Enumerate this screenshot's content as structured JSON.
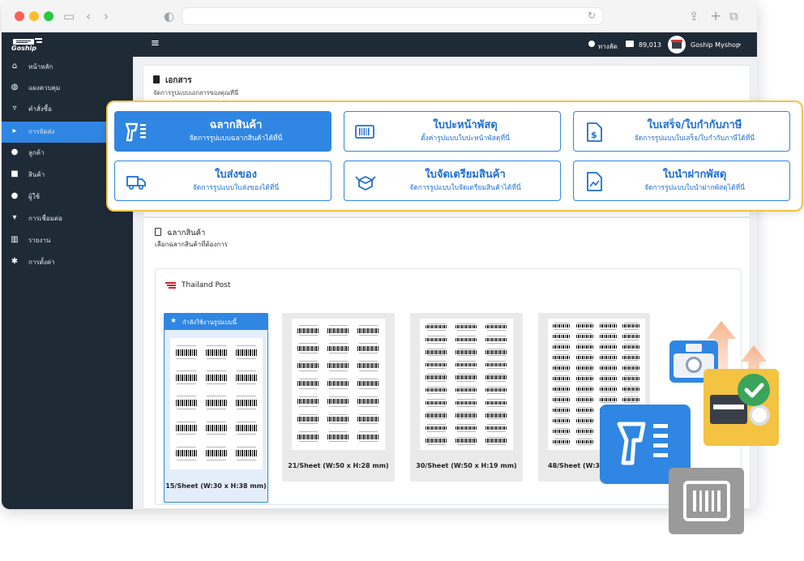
{
  "app": {
    "brand": "Goship",
    "shortcut_label": "ทางลัด",
    "balance": "89,013",
    "shop_name": "Goship Myshop"
  },
  "sidebar": {
    "items": [
      {
        "label": "หน้าหลัก",
        "icon": "home-icon",
        "glyph": "⌂"
      },
      {
        "label": "แผงควบคุม",
        "icon": "dashboard-icon",
        "glyph": "◍"
      },
      {
        "label": "คำสั่งซื้อ",
        "icon": "cart-icon",
        "glyph": "▿"
      },
      {
        "label": "การจัดส่ง",
        "icon": "truck-icon",
        "glyph": "▸",
        "active": true
      },
      {
        "label": "ลูกค้า",
        "icon": "users-icon",
        "glyph": "●"
      },
      {
        "label": "สินค้า",
        "icon": "box-icon",
        "glyph": "■"
      },
      {
        "label": "ผู้ใช้",
        "icon": "user-icon",
        "glyph": "●"
      },
      {
        "label": "การเชื่อมต่อ",
        "icon": "plug-icon",
        "glyph": "▾"
      },
      {
        "label": "รายงาน",
        "icon": "chart-icon",
        "glyph": "▥"
      },
      {
        "label": "การตั้งค่า",
        "icon": "gear-icon",
        "glyph": "✱"
      }
    ]
  },
  "documents": {
    "title": "เอกสาร",
    "subtitle": "จัดการรูปแบบเอกสารของคุณที่นี่",
    "cards": [
      {
        "title": "ฉลากสินค้า",
        "sub": "จัดการรูปแบบฉลากสินค้าได้ที่นี่",
        "icon": "label-printer-icon",
        "active": true
      },
      {
        "title": "ใบปะหน้าพัสดุ",
        "sub": "ตั้งค่ารูปแบบใบปะหน้าพัสดุที่นี่",
        "icon": "barcode-icon"
      },
      {
        "title": "ใบเสร็จ/ใบกำกับภาษี",
        "sub": "จัดการรูปแบบใบเสร็จ/ใบกำกับภาษีได้ที่นี่",
        "icon": "receipt-icon"
      },
      {
        "title": "ใบส่งของ",
        "sub": "จัดการรูปแบบใบส่งของได้ที่นี่",
        "icon": "delivery-truck-icon"
      },
      {
        "title": "ใบจัดเตรียมสินค้า",
        "sub": "จัดการรูปแบบใบจัดเตรียมสินค้าได้ที่นี่",
        "icon": "open-box-icon"
      },
      {
        "title": "ใบนำฝากพัสดุ",
        "sub": "จัดการรูปแบบใบนำฝากพัสดุได้ที่นี่",
        "icon": "document-chart-icon"
      }
    ]
  },
  "labels": {
    "title": "ฉลากสินค้า",
    "subtitle": "เลือกฉลากสินค้าที่ต้องการ",
    "carrier": "Thailand Post",
    "current_badge": "กำลังใช้งานรูปแบบนี้",
    "sheets": [
      {
        "caption": "15/Sheet (W:30 x H:38 mm)",
        "selected": true
      },
      {
        "caption": "21/Sheet (W:50 x H:28 mm)"
      },
      {
        "caption": "30/Sheet (W:50 x H:19 mm)"
      },
      {
        "caption": "48/Sheet (W:37"
      }
    ]
  },
  "colors": {
    "primary": "#2f86e3",
    "highlight_border": "#f5c342",
    "dark": "#1f2a37"
  }
}
